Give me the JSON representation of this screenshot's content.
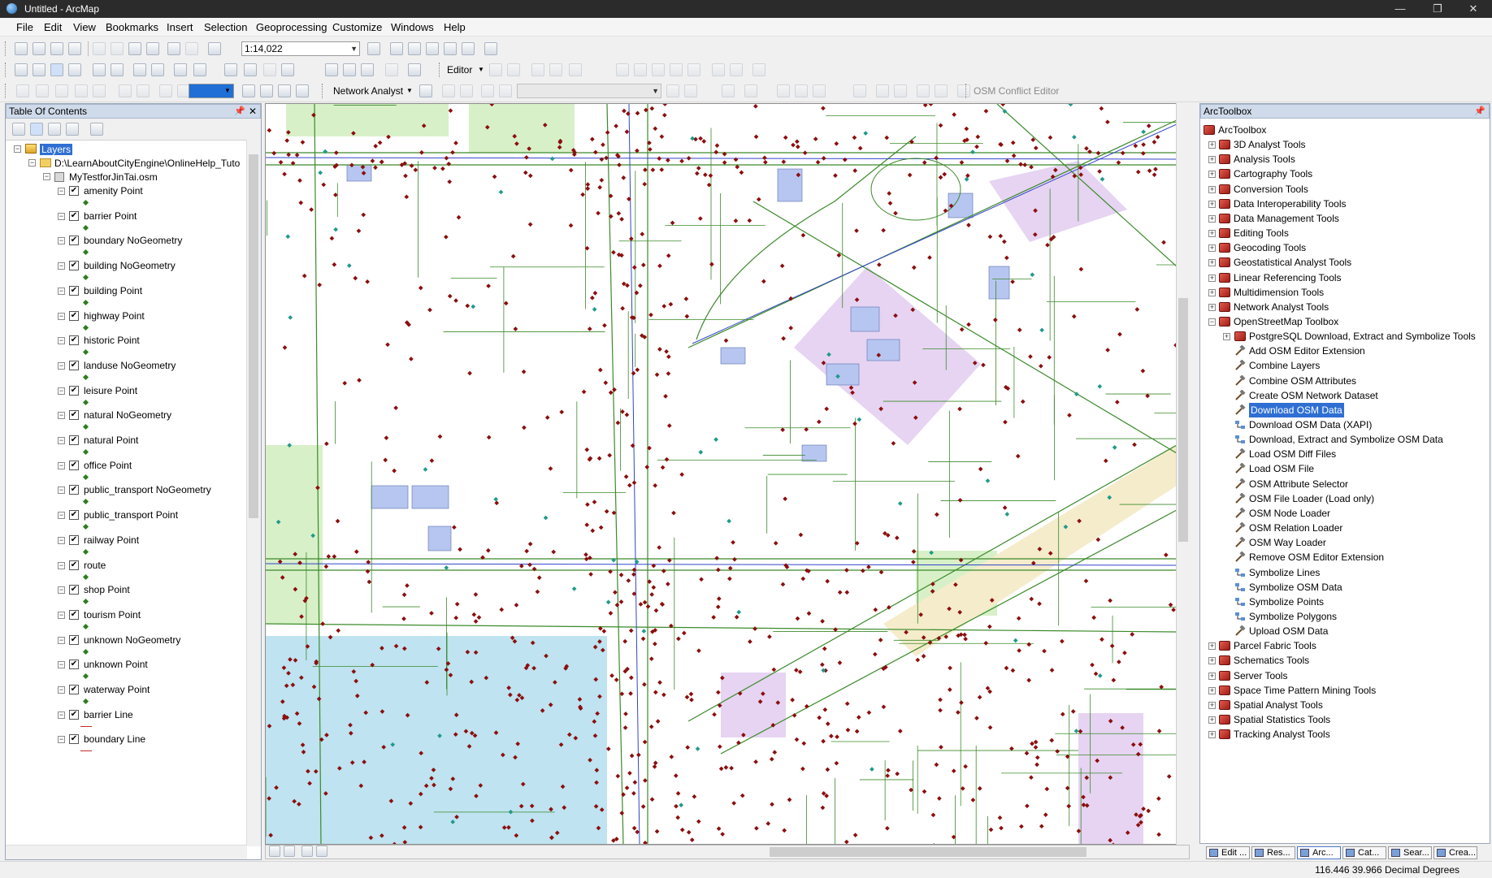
{
  "window": {
    "title": "Untitled - ArcMap"
  },
  "menu": [
    "File",
    "Edit",
    "View",
    "Bookmarks",
    "Insert",
    "Selection",
    "Geoprocessing",
    "Customize",
    "Windows",
    "Help"
  ],
  "toolbar": {
    "scale": "1:14,022",
    "editor_label": "Editor",
    "network_analyst_label": "Network Analyst",
    "osm_conflict_label": "OSM Conflict Editor"
  },
  "toc": {
    "title": "Table Of Contents",
    "root": "Layers",
    "folder": "D:\\LearnAboutCityEngine\\OnlineHelp_Tuto",
    "dataset": "MyTestforJinTai.osm",
    "layers": [
      {
        "name": "amenity Point",
        "symbol": "point"
      },
      {
        "name": "barrier Point",
        "symbol": "point"
      },
      {
        "name": "boundary NoGeometry",
        "symbol": "point"
      },
      {
        "name": "building NoGeometry",
        "symbol": "point"
      },
      {
        "name": "building Point",
        "symbol": "point"
      },
      {
        "name": "highway Point",
        "symbol": "point"
      },
      {
        "name": "historic Point",
        "symbol": "point"
      },
      {
        "name": "landuse NoGeometry",
        "symbol": "point"
      },
      {
        "name": "leisure Point",
        "symbol": "point"
      },
      {
        "name": "natural NoGeometry",
        "symbol": "point"
      },
      {
        "name": "natural Point",
        "symbol": "point"
      },
      {
        "name": "office Point",
        "symbol": "point"
      },
      {
        "name": "public_transport NoGeometry",
        "symbol": "point"
      },
      {
        "name": "public_transport Point",
        "symbol": "point"
      },
      {
        "name": "railway Point",
        "symbol": "point"
      },
      {
        "name": "route",
        "symbol": "point"
      },
      {
        "name": "shop Point",
        "symbol": "point"
      },
      {
        "name": "tourism Point",
        "symbol": "point"
      },
      {
        "name": "unknown NoGeometry",
        "symbol": "point"
      },
      {
        "name": "unknown Point",
        "symbol": "point"
      },
      {
        "name": "waterway Point",
        "symbol": "point"
      },
      {
        "name": "barrier Line",
        "symbol": "line"
      },
      {
        "name": "boundary Line",
        "symbol": "line"
      }
    ]
  },
  "arctoolbox": {
    "title": "ArcToolbox",
    "root": "ArcToolbox",
    "toolboxes_before": [
      "3D Analyst Tools",
      "Analysis Tools",
      "Cartography Tools",
      "Conversion Tools",
      "Data Interoperability Tools",
      "Data Management Tools",
      "Editing Tools",
      "Geocoding Tools",
      "Geostatistical Analyst Tools",
      "Linear Referencing Tools",
      "Multidimension Tools",
      "Network Analyst Tools"
    ],
    "osm_toolbox": "OpenStreetMap Toolbox",
    "osm_subtoolset": "PostgreSQL Download, Extract and Symbolize Tools",
    "osm_tools": [
      "Add OSM Editor Extension",
      "Combine Layers",
      "Combine OSM Attributes",
      "Create OSM Network Dataset",
      "Download OSM Data",
      "Download OSM Data (XAPI)",
      "Download, Extract and Symbolize OSM Data",
      "Load OSM Diff Files",
      "Load OSM File",
      "OSM Attribute Selector",
      "OSM File Loader (Load only)",
      "OSM Node Loader",
      "OSM Relation Loader",
      "OSM Way Loader",
      "Remove OSM Editor Extension",
      "Symbolize Lines",
      "Symbolize OSM Data",
      "Symbolize Points",
      "Symbolize Polygons",
      "Upload OSM Data"
    ],
    "selected_tool": "Download OSM Data",
    "toolboxes_after": [
      "Parcel Fabric Tools",
      "Schematics Tools",
      "Server Tools",
      "Space Time Pattern Mining Tools",
      "Spatial Analyst Tools",
      "Spatial Statistics Tools",
      "Tracking Analyst Tools"
    ]
  },
  "bottom_tabs": [
    "Edit ...",
    "Res...",
    "Arc...",
    "Cat...",
    "Sear...",
    "Crea..."
  ],
  "status": {
    "coordinates": "116.446  39.966 Decimal Degrees"
  },
  "colors": {
    "title_bar": "#2b2b2b",
    "pane_header": "#cfdaea",
    "selection": "#2f6fd3",
    "map_roads": "#3b8a2a",
    "map_points": "#8b0e0e",
    "water": "#bfe3f0",
    "building": "#b7c6f0",
    "park": "#d8f0c8"
  }
}
